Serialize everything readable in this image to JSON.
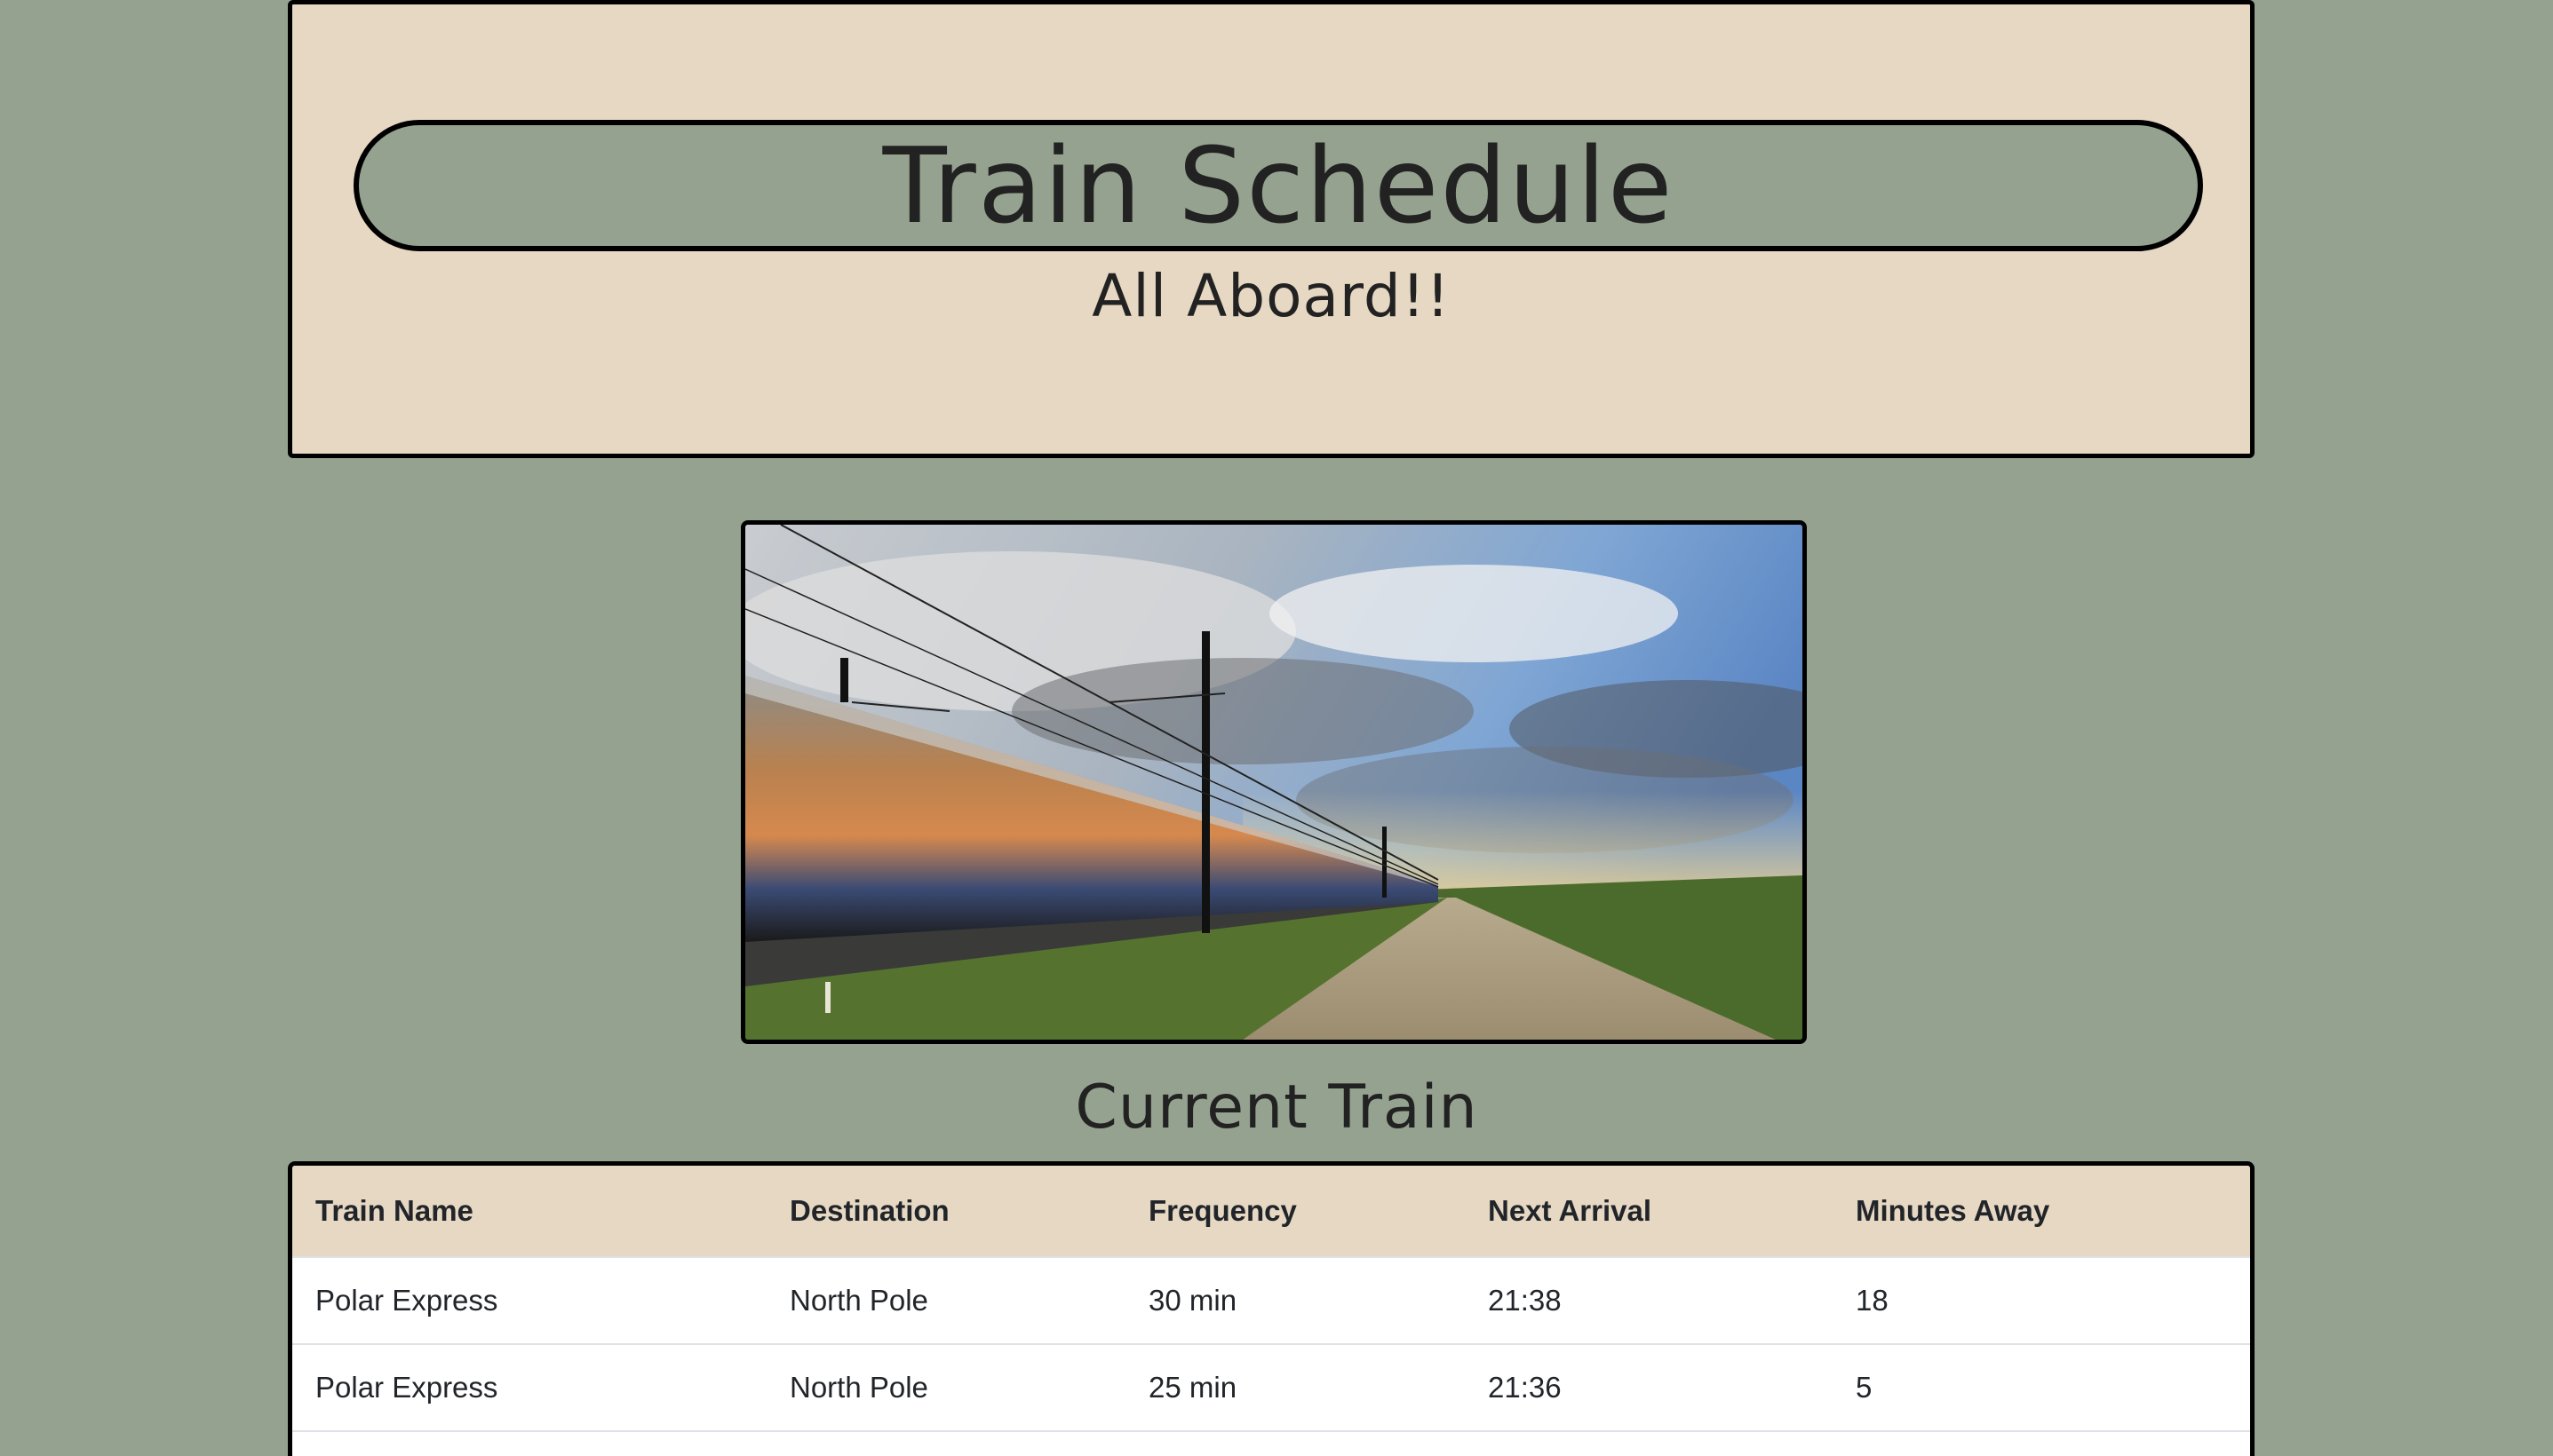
{
  "header": {
    "title": "Train Schedule",
    "subtitle": "All Aboard!!"
  },
  "hero": {
    "image_icon": "train-photo"
  },
  "current_train": {
    "heading": "Current Train",
    "columns": [
      "Train Name",
      "Destination",
      "Frequency",
      "Next Arrival",
      "Minutes Away"
    ],
    "rows": [
      [
        "Polar Express",
        "North Pole",
        "30 min",
        "21:38",
        "18"
      ],
      [
        "Polar Express",
        "North Pole",
        "25 min",
        "21:36",
        "5"
      ]
    ]
  },
  "colors": {
    "page_background": "#95a28f",
    "panel_background": "#e6d8c3",
    "border": "#000000",
    "text": "#222222"
  }
}
